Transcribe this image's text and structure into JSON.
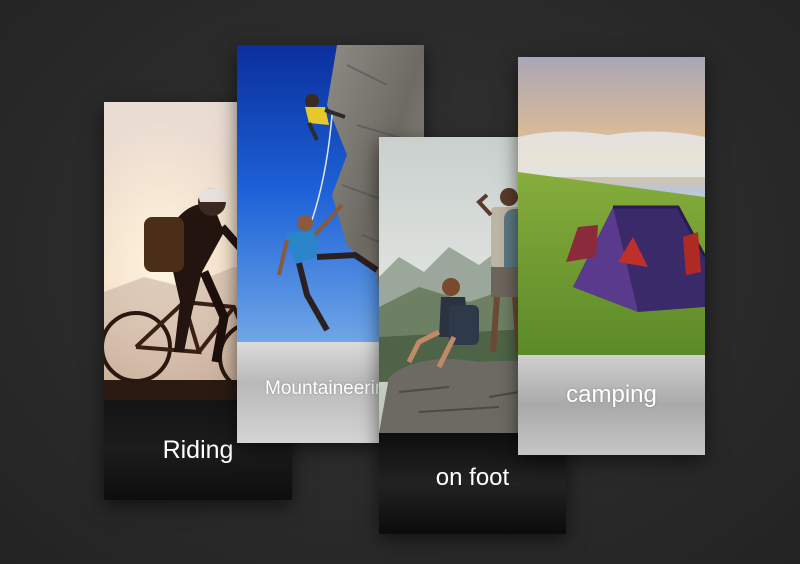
{
  "cards": {
    "riding": {
      "label": "Riding"
    },
    "mountaineering": {
      "label": "Mountaineering"
    },
    "on_foot": {
      "label": "on foot"
    },
    "camping": {
      "label": "camping"
    }
  }
}
